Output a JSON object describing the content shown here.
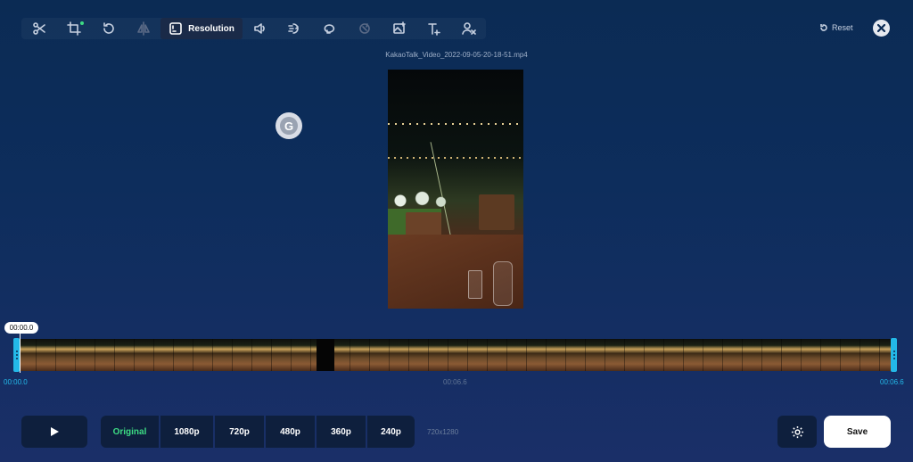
{
  "toolbar": {
    "tools": [
      {
        "name": "scissors-icon",
        "label": ""
      },
      {
        "name": "crop-icon",
        "label": ""
      },
      {
        "name": "rotate-icon",
        "label": ""
      },
      {
        "name": "flip-icon",
        "label": ""
      },
      {
        "name": "resolution-icon",
        "label": "Resolution"
      },
      {
        "name": "volume-icon",
        "label": ""
      },
      {
        "name": "speed-icon",
        "label": ""
      },
      {
        "name": "loop-icon",
        "label": ""
      },
      {
        "name": "reverse-icon",
        "label": ""
      },
      {
        "name": "add-image-icon",
        "label": ""
      },
      {
        "name": "add-text-icon",
        "label": ""
      },
      {
        "name": "remove-audio-icon",
        "label": ""
      }
    ],
    "active_label": "Resolution"
  },
  "header": {
    "reset_label": "Reset",
    "filename": "KakaoTalk_Video_2022-09-05-20-18-51.mp4"
  },
  "overlay": {
    "badge_letter": "G"
  },
  "timeline": {
    "current_time": "00:00.0",
    "start_time": "00:00.0",
    "mid_time": "00:06.6",
    "end_time": "00:06.6"
  },
  "controls": {
    "resolutions": [
      "Original",
      "1080p",
      "720p",
      "480p",
      "360p",
      "240p"
    ],
    "selected_resolution": "Original",
    "dimensions": "720x1280",
    "save_label": "Save"
  },
  "colors": {
    "accent_green": "#3ddc84",
    "accent_cyan": "#23b8e8",
    "background": "#0d2d5c"
  }
}
